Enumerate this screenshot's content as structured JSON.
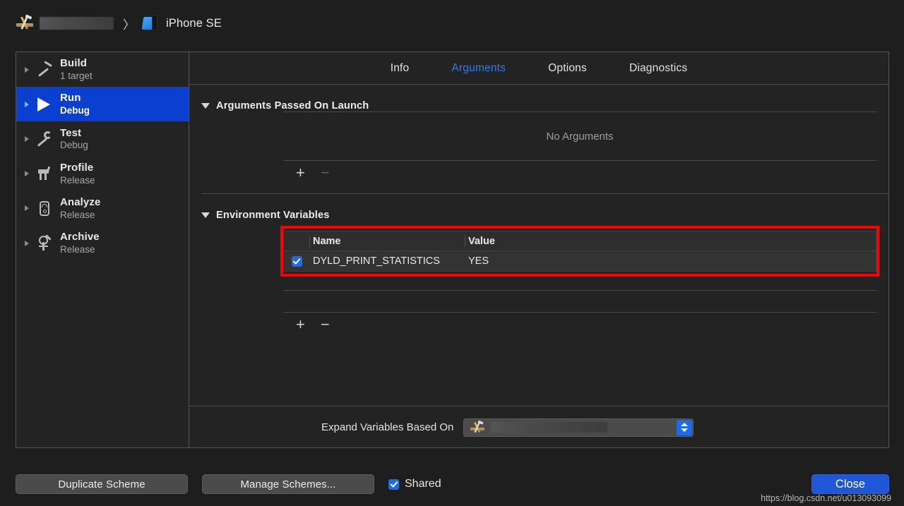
{
  "breadcrumb": {
    "project_icon": "xcode-icon",
    "project_name_redacted": "",
    "separator": "〉",
    "device_icon": "simulator-icon",
    "device": "iPhone SE"
  },
  "sidebar": {
    "items": [
      {
        "title": "Build",
        "subtitle": "1 target",
        "icon": "hammer-icon",
        "selected": false
      },
      {
        "title": "Run",
        "subtitle": "Debug",
        "icon": "play-icon",
        "selected": true
      },
      {
        "title": "Test",
        "subtitle": "Debug",
        "icon": "wrench-icon",
        "selected": false
      },
      {
        "title": "Profile",
        "subtitle": "Release",
        "icon": "gauge-icon",
        "selected": false
      },
      {
        "title": "Analyze",
        "subtitle": "Release",
        "icon": "magnifier-icon",
        "selected": false
      },
      {
        "title": "Archive",
        "subtitle": "Release",
        "icon": "archive-icon",
        "selected": false
      }
    ]
  },
  "tabs": [
    {
      "label": "Info",
      "active": false
    },
    {
      "label": "Arguments",
      "active": true
    },
    {
      "label": "Options",
      "active": false
    },
    {
      "label": "Diagnostics",
      "active": false
    }
  ],
  "arguments_section": {
    "title": "Arguments Passed On Launch",
    "empty_message": "No Arguments",
    "add_label": "+",
    "remove_label": "−",
    "remove_enabled": false
  },
  "environment_section": {
    "title": "Environment Variables",
    "columns": [
      "Name",
      "Value"
    ],
    "rows": [
      {
        "enabled": true,
        "name": "DYLD_PRINT_STATISTICS",
        "value": "YES"
      }
    ],
    "add_label": "+",
    "remove_label": "−",
    "remove_enabled": true,
    "highlight_color": "#fe0000"
  },
  "footer": {
    "expand_label": "Expand Variables Based On",
    "popup_value_redacted": "",
    "popup_icon": "xcode-icon"
  },
  "bottom_bar": {
    "duplicate_scheme": "Duplicate Scheme",
    "manage_schemes": "Manage Schemes...",
    "shared_label": "Shared",
    "shared_checked": true,
    "close": "Close"
  },
  "watermark": "https://blog.csdn.net/u013093099",
  "colors": {
    "accent_blue": "#2f7bf6",
    "selection_blue": "#0b3fd1",
    "checkbox_blue": "#1b6ce8",
    "close_blue": "#1f57d8",
    "highlight_red": "#fe0000",
    "window_bg": "#232323",
    "page_bg": "#1e1e1e"
  }
}
